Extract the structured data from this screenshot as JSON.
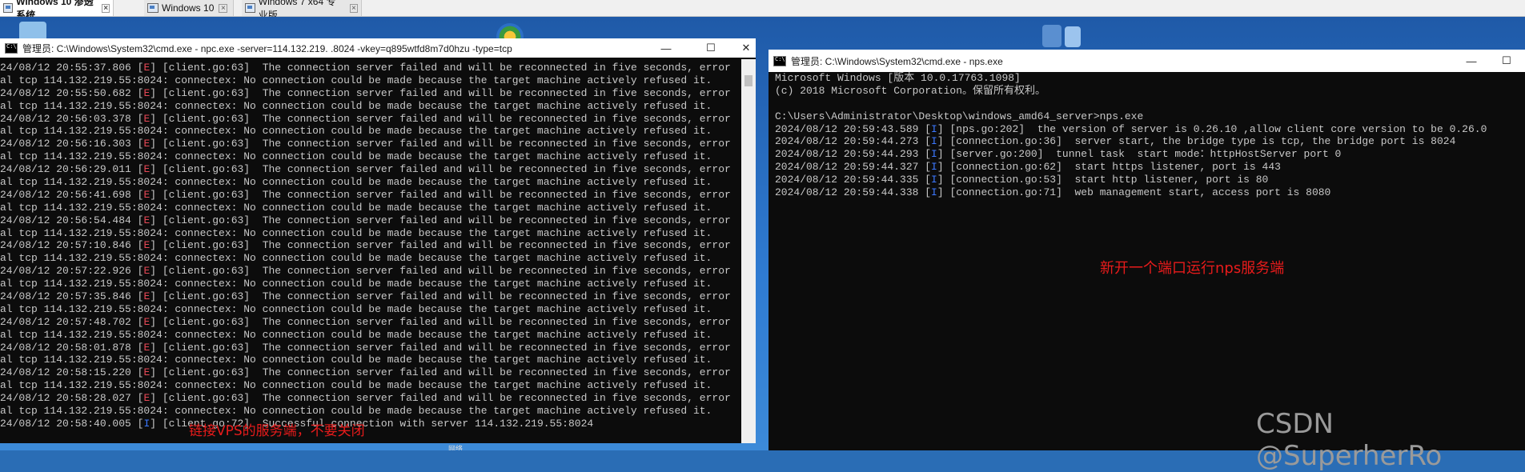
{
  "tabs": [
    {
      "label": "Windows 10 渗透系统",
      "active": true
    },
    {
      "label": "Windows 10",
      "active": false
    },
    {
      "label": "Windows 7 x64 专业版",
      "active": false
    }
  ],
  "tab_close_glyph": "×",
  "npc_window": {
    "title": "管理员: C:\\Windows\\System32\\cmd.exe - npc.exe  -server=114.132.219.    .8024 -vkey=q895wtfd8m7d0hzu -type=tcp",
    "minimize": "—",
    "maximize": "☐",
    "close": "✕",
    "lines": [
      {
        "pre": "24/08/12 20:55:37.806 ",
        "tag": "E",
        "post": " [client.go:63]  The connection server failed and will be reconnected in five seconds, error"
      },
      {
        "pre": "al tcp 114.132.219.55:8024: connectex: No connection could be made because the target machine actively refused it.",
        "tag": "",
        "post": ""
      },
      {
        "pre": "24/08/12 20:55:50.682 ",
        "tag": "E",
        "post": " [client.go:63]  The connection server failed and will be reconnected in five seconds, error"
      },
      {
        "pre": "al tcp 114.132.219.55:8024: connectex: No connection could be made because the target machine actively refused it.",
        "tag": "",
        "post": ""
      },
      {
        "pre": "24/08/12 20:56:03.378 ",
        "tag": "E",
        "post": " [client.go:63]  The connection server failed and will be reconnected in five seconds, error"
      },
      {
        "pre": "al tcp 114.132.219.55:8024: connectex: No connection could be made because the target machine actively refused it.",
        "tag": "",
        "post": ""
      },
      {
        "pre": "24/08/12 20:56:16.303 ",
        "tag": "E",
        "post": " [client.go:63]  The connection server failed and will be reconnected in five seconds, error"
      },
      {
        "pre": "al tcp 114.132.219.55:8024: connectex: No connection could be made because the target machine actively refused it.",
        "tag": "",
        "post": ""
      },
      {
        "pre": "24/08/12 20:56:29.011 ",
        "tag": "E",
        "post": " [client.go:63]  The connection server failed and will be reconnected in five seconds, error"
      },
      {
        "pre": "al tcp 114.132.219.55:8024: connectex: No connection could be made because the target machine actively refused it.",
        "tag": "",
        "post": ""
      },
      {
        "pre": "24/08/12 20:56:41.698 ",
        "tag": "E",
        "post": " [client.go:63]  The connection server failed and will be reconnected in five seconds, error"
      },
      {
        "pre": "al tcp 114.132.219.55:8024: connectex: No connection could be made because the target machine actively refused it.",
        "tag": "",
        "post": ""
      },
      {
        "pre": "24/08/12 20:56:54.484 ",
        "tag": "E",
        "post": " [client.go:63]  The connection server failed and will be reconnected in five seconds, error"
      },
      {
        "pre": "al tcp 114.132.219.55:8024: connectex: No connection could be made because the target machine actively refused it.",
        "tag": "",
        "post": ""
      },
      {
        "pre": "24/08/12 20:57:10.846 ",
        "tag": "E",
        "post": " [client.go:63]  The connection server failed and will be reconnected in five seconds, error"
      },
      {
        "pre": "al tcp 114.132.219.55:8024: connectex: No connection could be made because the target machine actively refused it.",
        "tag": "",
        "post": ""
      },
      {
        "pre": "24/08/12 20:57:22.926 ",
        "tag": "E",
        "post": " [client.go:63]  The connection server failed and will be reconnected in five seconds, error"
      },
      {
        "pre": "al tcp 114.132.219.55:8024: connectex: No connection could be made because the target machine actively refused it.",
        "tag": "",
        "post": ""
      },
      {
        "pre": "24/08/12 20:57:35.846 ",
        "tag": "E",
        "post": " [client.go:63]  The connection server failed and will be reconnected in five seconds, error"
      },
      {
        "pre": "al tcp 114.132.219.55:8024: connectex: No connection could be made because the target machine actively refused it.",
        "tag": "",
        "post": ""
      },
      {
        "pre": "24/08/12 20:57:48.702 ",
        "tag": "E",
        "post": " [client.go:63]  The connection server failed and will be reconnected in five seconds, error"
      },
      {
        "pre": "al tcp 114.132.219.55:8024: connectex: No connection could be made because the target machine actively refused it.",
        "tag": "",
        "post": ""
      },
      {
        "pre": "24/08/12 20:58:01.878 ",
        "tag": "E",
        "post": " [client.go:63]  The connection server failed and will be reconnected in five seconds, error"
      },
      {
        "pre": "al tcp 114.132.219.55:8024: connectex: No connection could be made because the target machine actively refused it.",
        "tag": "",
        "post": ""
      },
      {
        "pre": "24/08/12 20:58:15.220 ",
        "tag": "E",
        "post": " [client.go:63]  The connection server failed and will be reconnected in five seconds, error"
      },
      {
        "pre": "al tcp 114.132.219.55:8024: connectex: No connection could be made because the target machine actively refused it.",
        "tag": "",
        "post": ""
      },
      {
        "pre": "24/08/12 20:58:28.027 ",
        "tag": "E",
        "post": " [client.go:63]  The connection server failed and will be reconnected in five seconds, error"
      },
      {
        "pre": "al tcp 114.132.219.55:8024: connectex: No connection could be made because the target machine actively refused it.",
        "tag": "",
        "post": ""
      },
      {
        "pre": "24/08/12 20:58:40.005 ",
        "tag": "I",
        "post": " [client.go:72]  Successful connection with server 114.132.219.55:8024"
      }
    ],
    "annotation": "链接VPS的服务端，不要关闭"
  },
  "nps_window": {
    "title": "管理员: C:\\Windows\\System32\\cmd.exe - nps.exe",
    "minimize": "—",
    "maximize": "☐",
    "close": "✕",
    "lines": [
      {
        "pre": "Microsoft Windows [版本 10.0.17763.1098]",
        "tag": "",
        "post": ""
      },
      {
        "pre": "(c) 2018 Microsoft Corporation。保留所有权利。",
        "tag": "",
        "post": ""
      },
      {
        "pre": "",
        "tag": "",
        "post": ""
      },
      {
        "pre": "C:\\Users\\Administrator\\Desktop\\windows_amd64_server>nps.exe",
        "tag": "",
        "post": ""
      },
      {
        "pre": "2024/08/12 20:59:43.589 ",
        "tag": "I",
        "post": " [nps.go:202]  the version of server is 0.26.10 ,allow client core version to be 0.26.0"
      },
      {
        "pre": "2024/08/12 20:59:44.273 ",
        "tag": "I",
        "post": " [connection.go:36]  server start, the bridge type is tcp, the bridge port is 8024"
      },
      {
        "pre": "2024/08/12 20:59:44.293 ",
        "tag": "I",
        "post": " [server.go:200]  tunnel task  start mode：httpHostServer port 0"
      },
      {
        "pre": "2024/08/12 20:59:44.327 ",
        "tag": "I",
        "post": " [connection.go:62]  start https listener, port is 443"
      },
      {
        "pre": "2024/08/12 20:59:44.335 ",
        "tag": "I",
        "post": " [connection.go:53]  start http listener, port is 80"
      },
      {
        "pre": "2024/08/12 20:59:44.338 ",
        "tag": "I",
        "post": " [connection.go:71]  web management start, access port is 8080"
      }
    ],
    "annotation": "新开一个端口运行nps服务端"
  },
  "taskbar_fragment": "网络",
  "watermark": "CSDN @SuperherRo",
  "colors": {
    "error_tag": "#e74856",
    "info_tag": "#3b78ff",
    "annotation": "#e81b1b"
  }
}
